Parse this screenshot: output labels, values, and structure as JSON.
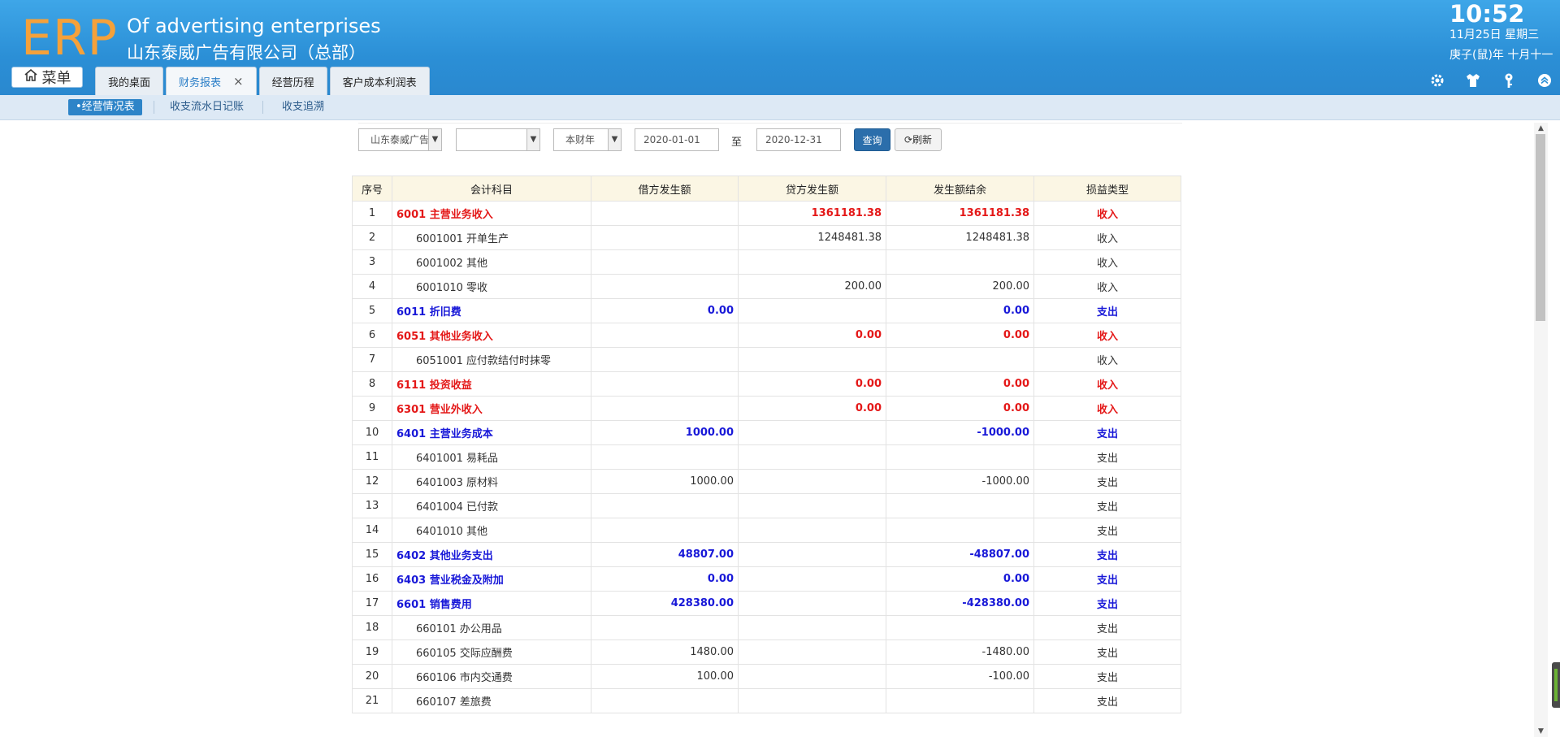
{
  "header": {
    "logo": "ERP",
    "title_en": "Of advertising enterprises",
    "title_cn": "山东泰威广告有限公司（总部）",
    "time": "10:52",
    "date": "11月25日 星期三",
    "lunar": "庚子(鼠)年 十月十一",
    "menu_label": "菜单",
    "tabs": [
      {
        "label": "我的桌面"
      },
      {
        "label": "财务报表",
        "close": "×"
      },
      {
        "label": "经营历程"
      },
      {
        "label": "客户成本利润表"
      }
    ],
    "icons": [
      "gear-icon",
      "shirt-icon",
      "key-icon",
      "collapse-icon"
    ]
  },
  "subnav": {
    "items": [
      "•经营情况表",
      "收支流水日记账",
      "收支追溯"
    ]
  },
  "filters": {
    "company": "山东泰威广告",
    "second": "",
    "period": "本财年",
    "start_date": "2020-01-01",
    "to": "至",
    "end_date": "2020-12-31",
    "query": "查询",
    "refresh": "刷新"
  },
  "table": {
    "columns": [
      "序号",
      "会计科目",
      "借方发生额",
      "贷方发生额",
      "发生额结余",
      "损益类型"
    ],
    "rows": [
      {
        "no": "1",
        "subject": "6001 主营业务收入",
        "debit": "",
        "credit": "1361181.38",
        "balance": "1361181.38",
        "type": "收入",
        "style": "red",
        "indent": false
      },
      {
        "no": "2",
        "subject": "6001001 开单生产",
        "debit": "",
        "credit": "1248481.38",
        "balance": "1248481.38",
        "type": "收入",
        "style": "",
        "indent": true
      },
      {
        "no": "3",
        "subject": "6001002 其他",
        "debit": "",
        "credit": "",
        "balance": "",
        "type": "收入",
        "style": "",
        "indent": true
      },
      {
        "no": "4",
        "subject": "6001010 零收",
        "debit": "",
        "credit": "200.00",
        "balance": "200.00",
        "type": "收入",
        "style": "",
        "indent": true
      },
      {
        "no": "5",
        "subject": "6011 折旧费",
        "debit": "0.00",
        "credit": "",
        "balance": "0.00",
        "type": "支出",
        "style": "blue",
        "indent": false
      },
      {
        "no": "6",
        "subject": "6051 其他业务收入",
        "debit": "",
        "credit": "0.00",
        "balance": "0.00",
        "type": "收入",
        "style": "red",
        "indent": false
      },
      {
        "no": "7",
        "subject": "6051001 应付款结付时抹零",
        "debit": "",
        "credit": "",
        "balance": "",
        "type": "收入",
        "style": "",
        "indent": true
      },
      {
        "no": "8",
        "subject": "6111 投资收益",
        "debit": "",
        "credit": "0.00",
        "balance": "0.00",
        "type": "收入",
        "style": "red",
        "indent": false
      },
      {
        "no": "9",
        "subject": "6301 营业外收入",
        "debit": "",
        "credit": "0.00",
        "balance": "0.00",
        "type": "收入",
        "style": "red",
        "indent": false
      },
      {
        "no": "10",
        "subject": "6401 主营业务成本",
        "debit": "1000.00",
        "credit": "",
        "balance": "-1000.00",
        "type": "支出",
        "style": "blue",
        "indent": false
      },
      {
        "no": "11",
        "subject": "6401001 易耗品",
        "debit": "",
        "credit": "",
        "balance": "",
        "type": "支出",
        "style": "",
        "indent": true
      },
      {
        "no": "12",
        "subject": "6401003 原材料",
        "debit": "1000.00",
        "credit": "",
        "balance": "-1000.00",
        "type": "支出",
        "style": "",
        "indent": true
      },
      {
        "no": "13",
        "subject": "6401004 已付款",
        "debit": "",
        "credit": "",
        "balance": "",
        "type": "支出",
        "style": "",
        "indent": true
      },
      {
        "no": "14",
        "subject": "6401010 其他",
        "debit": "",
        "credit": "",
        "balance": "",
        "type": "支出",
        "style": "",
        "indent": true
      },
      {
        "no": "15",
        "subject": "6402 其他业务支出",
        "debit": "48807.00",
        "credit": "",
        "balance": "-48807.00",
        "type": "支出",
        "style": "blue",
        "indent": false
      },
      {
        "no": "16",
        "subject": "6403 营业税金及附加",
        "debit": "0.00",
        "credit": "",
        "balance": "0.00",
        "type": "支出",
        "style": "blue",
        "indent": false
      },
      {
        "no": "17",
        "subject": "6601 销售费用",
        "debit": "428380.00",
        "credit": "",
        "balance": "-428380.00",
        "type": "支出",
        "style": "blue",
        "indent": false
      },
      {
        "no": "18",
        "subject": "660101 办公用品",
        "debit": "",
        "credit": "",
        "balance": "",
        "type": "支出",
        "style": "",
        "indent": true
      },
      {
        "no": "19",
        "subject": "660105 交际应酬费",
        "debit": "1480.00",
        "credit": "",
        "balance": "-1480.00",
        "type": "支出",
        "style": "",
        "indent": true
      },
      {
        "no": "20",
        "subject": "660106 市内交通费",
        "debit": "100.00",
        "credit": "",
        "balance": "-100.00",
        "type": "支出",
        "style": "",
        "indent": true
      },
      {
        "no": "21",
        "subject": "660107 差旅费",
        "debit": "",
        "credit": "",
        "balance": "",
        "type": "支出",
        "style": "",
        "indent": true
      }
    ]
  },
  "colors": {
    "header_blue": "#2b8fd6",
    "logo_orange": "#f5a13a",
    "income_red": "#e41818",
    "expense_blue": "#1818d8",
    "table_header_bg": "#fbf6e4",
    "query_button": "#2b6eab"
  }
}
